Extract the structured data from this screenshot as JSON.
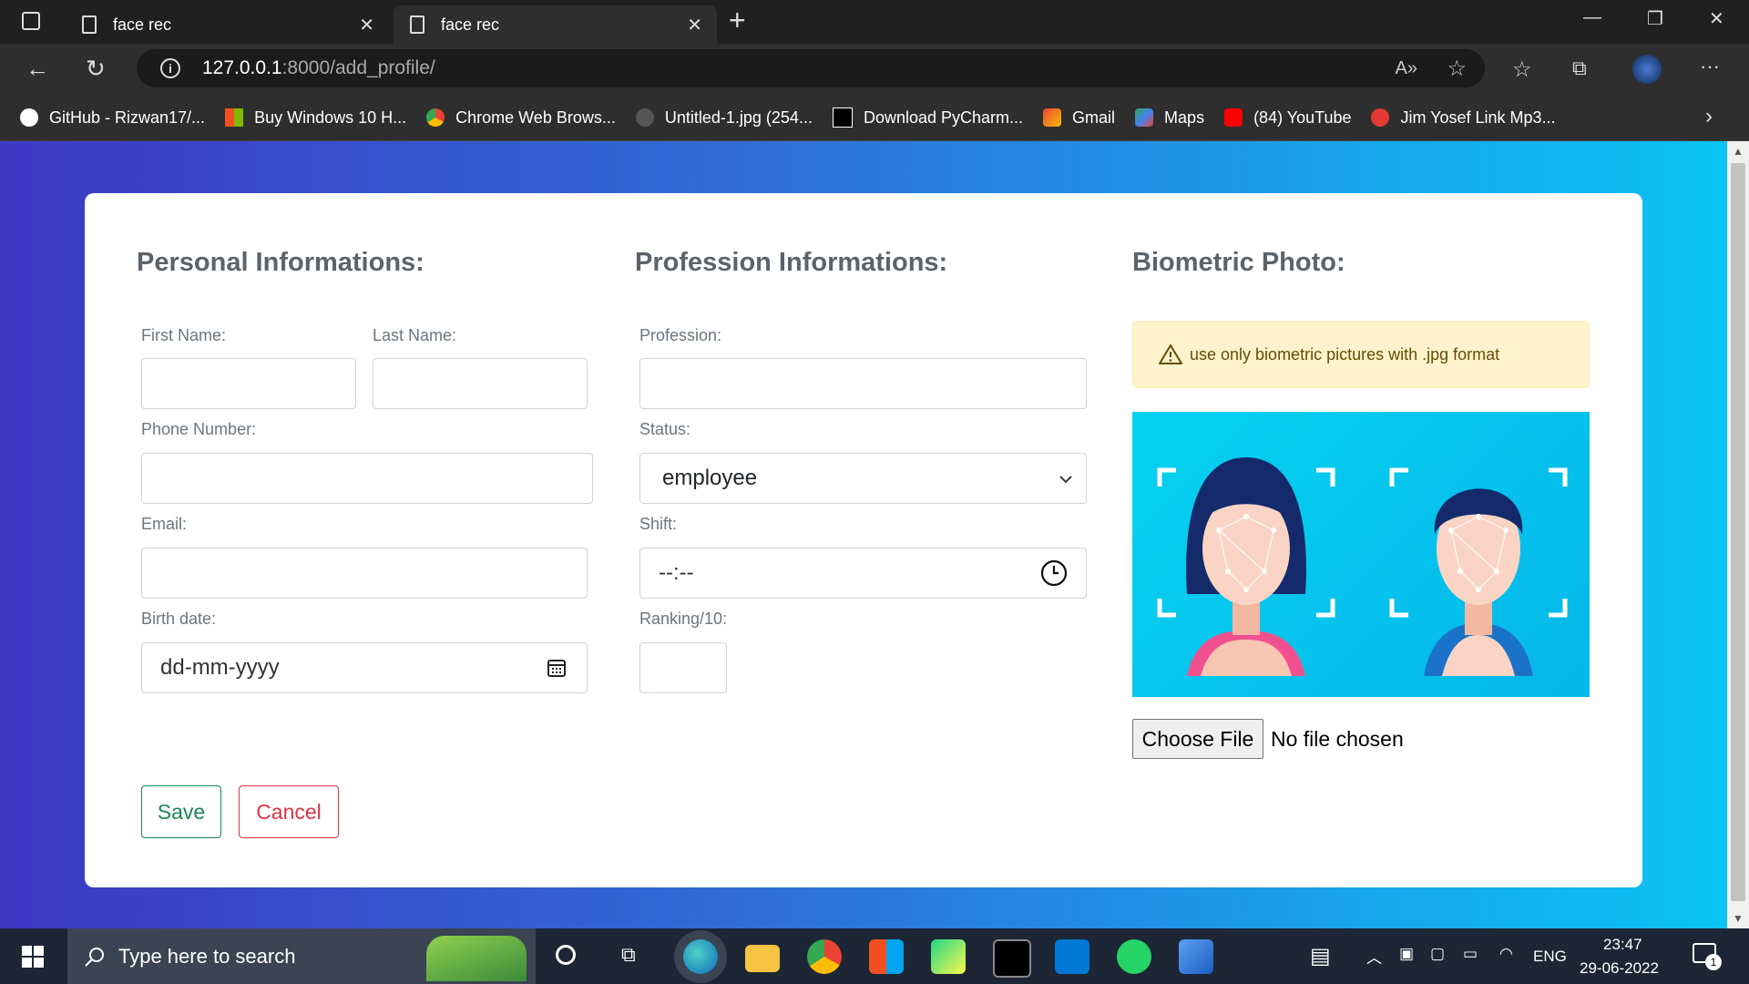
{
  "browser": {
    "tabs": [
      {
        "title": "face rec"
      },
      {
        "title": "face rec"
      }
    ],
    "url": {
      "host": "127.0.0.1",
      "path": ":8000/add_profile/"
    },
    "bookmarks": [
      {
        "label": "GitHub - Rizwan17/...",
        "icon": "github-icon",
        "color": "#ffffff"
      },
      {
        "label": "Buy Windows 10 H...",
        "icon": "windows-icon",
        "color": "#f25022"
      },
      {
        "label": "Chrome Web Brows...",
        "icon": "chrome-icon",
        "color": "#fbbc05"
      },
      {
        "label": "Untitled-1.jpg (254...",
        "icon": "photopea-icon",
        "color": "#888888"
      },
      {
        "label": "Download PyCharm...",
        "icon": "jetbrains-icon",
        "color": "#000000"
      },
      {
        "label": "Gmail",
        "icon": "gmail-icon",
        "color": "#ea4335"
      },
      {
        "label": "Maps",
        "icon": "maps-icon",
        "color": "#34a853"
      },
      {
        "label": "(84) YouTube",
        "icon": "youtube-icon",
        "color": "#ff0000"
      },
      {
        "label": "Jim Yosef Link Mp3...",
        "icon": "music-icon",
        "color": "#e53935"
      }
    ]
  },
  "form": {
    "personal": {
      "title": "Personal Informations:",
      "first_name_label": "First Name:",
      "last_name_label": "Last Name:",
      "phone_label": "Phone Number:",
      "email_label": "Email:",
      "birth_label": "Birth date:",
      "birth_placeholder": "dd-mm-yyyy"
    },
    "profession": {
      "title": "Profession Informations:",
      "profession_label": "Profession:",
      "status_label": "Status:",
      "status_value": "employee",
      "shift_label": "Shift:",
      "shift_placeholder": "--:--",
      "ranking_label": "Ranking/10:"
    },
    "biometric": {
      "title": "Biometric Photo:",
      "alert": "use only biometric pictures with .jpg format",
      "choose_file": "Choose File",
      "no_file": "No file chosen"
    },
    "actions": {
      "save": "Save",
      "cancel": "Cancel"
    }
  },
  "taskbar": {
    "search_placeholder": "Type here to search",
    "language": "ENG",
    "time": "23:47",
    "date": "29-06-2022",
    "notification_count": "1"
  },
  "colors": {
    "accent_green": "#198754",
    "accent_red": "#dc3545",
    "alert_bg": "#fff3cd"
  }
}
